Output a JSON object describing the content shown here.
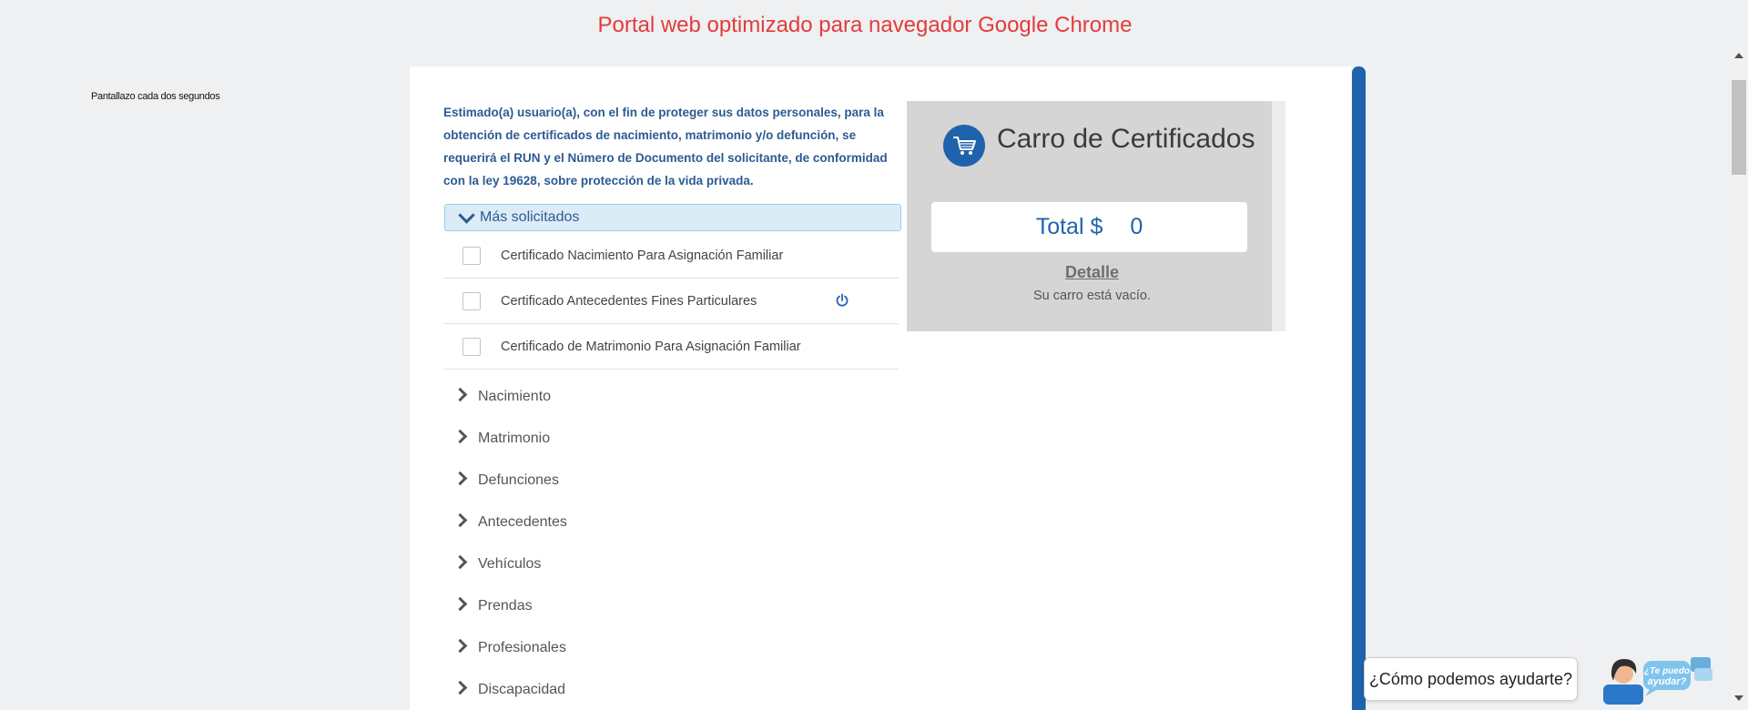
{
  "banner": {
    "text": "Portal web optimizado para navegador Google Chrome"
  },
  "side_note": "Pantallazo cada dos segundos",
  "privacy_notice": "Estimado(a) usuario(a), con el fin de proteger sus datos personales, para la obtención de certificados de nacimiento, matrimonio y/o defunción, se requerirá el RUN y el Número de Documento del solicitante, de conformidad con la ley 19628, sobre protección de la vida privada.",
  "most_requested": {
    "title": "Más solicitados",
    "items": [
      {
        "label": "Certificado Nacimiento Para Asignación Familiar",
        "checked": false
      },
      {
        "label": "Certificado Antecedentes Fines Particulares",
        "checked": false,
        "icon": "power-icon"
      },
      {
        "label": "Certificado de Matrimonio Para Asignación Familiar",
        "checked": false
      }
    ]
  },
  "categories": [
    "Nacimiento",
    "Matrimonio",
    "Defunciones",
    "Antecedentes",
    "Vehículos",
    "Prendas",
    "Profesionales",
    "Discapacidad"
  ],
  "cart": {
    "title": "Carro de Certificados",
    "total_label": "Total $",
    "total_value": "0",
    "detail_link": "Detalle",
    "empty_message": "Su carro está vacío."
  },
  "chat": {
    "prompt": "¿Cómo podemos ayudarte?",
    "avatar_text_line1": "¿Te puedo",
    "avatar_text_line2": "ayudar?"
  },
  "colors": {
    "banner_red": "#e43b3b",
    "brand_blue": "#1f63ac",
    "notice_blue": "#2c5a93",
    "cart_panel_gray": "#d5d5d5"
  }
}
